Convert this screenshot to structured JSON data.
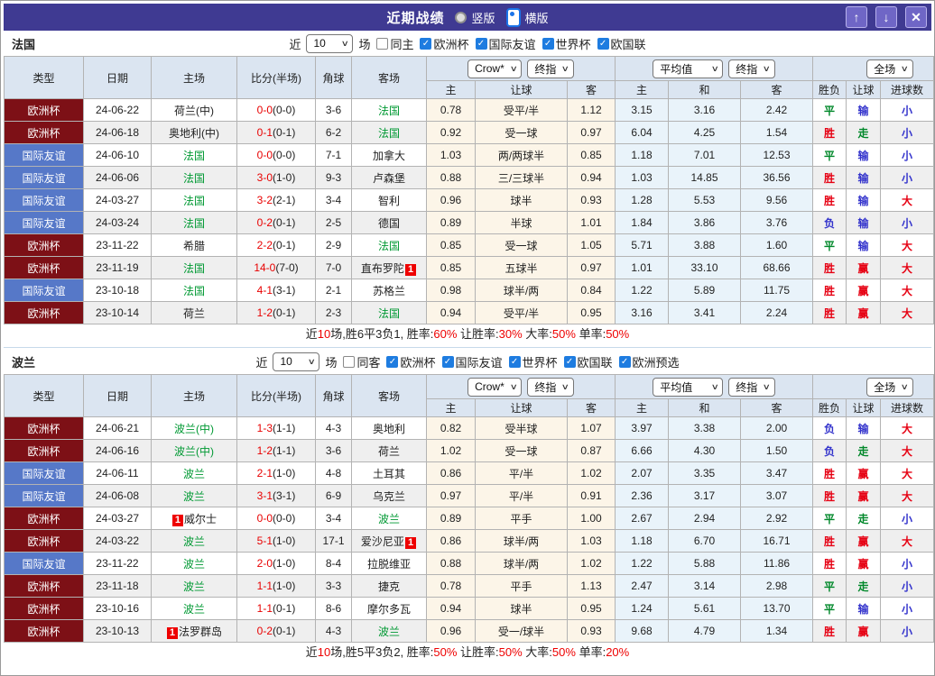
{
  "titlebar": {
    "title": "近期战绩",
    "radio_vertical": "竖版",
    "radio_horizontal": "横版",
    "up_icon": "↑",
    "down_icon": "↓",
    "close_icon": "✕"
  },
  "colors": {
    "titlebar_bg": "#3f3a92",
    "euro_cup_bg": "#7d1016",
    "friendly_bg": "#5678c8",
    "focus_team_green": "#009933",
    "score_red": "#e80000",
    "win_red": "#e60012",
    "draw_green": "#00882a",
    "loss_blue": "#3333cc",
    "odds_cream_bg": "#fcf5e8",
    "avg_blue_bg": "#e9f3fa"
  },
  "table_header": {
    "cols": [
      "类型",
      "日期",
      "主场",
      "比分(半场)",
      "角球",
      "客场"
    ],
    "dd_bookmaker": "Crow*",
    "dd_final_1": "终指",
    "dd_average": "平均值",
    "dd_final_2": "终指",
    "dd_fulltime": "全场",
    "sub_cols": [
      "主",
      "让球",
      "客",
      "主",
      "和",
      "客",
      "胜负",
      "让球",
      "进球数"
    ]
  },
  "sections": [
    {
      "team": "法国",
      "filter": {
        "near_label": "近",
        "count": "10",
        "games_label": "场",
        "same_label": "同主",
        "same_checked": false,
        "competitions": [
          "欧洲杯",
          "国际友谊",
          "世界杯",
          "欧国联"
        ]
      },
      "rows": [
        {
          "comp": "欧洲杯",
          "date": "24-06-22",
          "home": "荷兰(中)",
          "score": "0-0",
          "half": "(0-0)",
          "corner": "3-6",
          "away": "法国",
          "away_focus": true,
          "odds": [
            "0.78",
            "受平/半",
            "1.12"
          ],
          "avg": [
            "3.15",
            "3.16",
            "2.42"
          ],
          "res": [
            "平",
            "输",
            "小"
          ]
        },
        {
          "comp": "欧洲杯",
          "date": "24-06-18",
          "home": "奥地利(中)",
          "score": "0-1",
          "half": "(0-1)",
          "corner": "6-2",
          "away": "法国",
          "away_focus": true,
          "odds": [
            "0.92",
            "受一球",
            "0.97"
          ],
          "avg": [
            "6.04",
            "4.25",
            "1.54"
          ],
          "res": [
            "胜",
            "走",
            "小"
          ]
        },
        {
          "comp": "国际友谊",
          "date": "24-06-10",
          "home": "法国",
          "home_focus": true,
          "score": "0-0",
          "half": "(0-0)",
          "corner": "7-1",
          "away": "加拿大",
          "odds": [
            "1.03",
            "两/两球半",
            "0.85"
          ],
          "avg": [
            "1.18",
            "7.01",
            "12.53"
          ],
          "res": [
            "平",
            "输",
            "小"
          ]
        },
        {
          "comp": "国际友谊",
          "date": "24-06-06",
          "home": "法国",
          "home_focus": true,
          "score": "3-0",
          "half": "(1-0)",
          "corner": "9-3",
          "away": "卢森堡",
          "odds": [
            "0.88",
            "三/三球半",
            "0.94"
          ],
          "avg": [
            "1.03",
            "14.85",
            "36.56"
          ],
          "res": [
            "胜",
            "输",
            "小"
          ]
        },
        {
          "comp": "国际友谊",
          "date": "24-03-27",
          "home": "法国",
          "home_focus": true,
          "score": "3-2",
          "half": "(2-1)",
          "corner": "3-4",
          "away": "智利",
          "odds": [
            "0.96",
            "球半",
            "0.93"
          ],
          "avg": [
            "1.28",
            "5.53",
            "9.56"
          ],
          "res": [
            "胜",
            "输",
            "大"
          ]
        },
        {
          "comp": "国际友谊",
          "date": "24-03-24",
          "home": "法国",
          "home_focus": true,
          "score": "0-2",
          "half": "(0-1)",
          "corner": "2-5",
          "away": "德国",
          "odds": [
            "0.89",
            "半球",
            "1.01"
          ],
          "avg": [
            "1.84",
            "3.86",
            "3.76"
          ],
          "res": [
            "负",
            "输",
            "小"
          ]
        },
        {
          "comp": "欧洲杯",
          "date": "23-11-22",
          "home": "希腊",
          "score": "2-2",
          "half": "(0-1)",
          "corner": "2-9",
          "away": "法国",
          "away_focus": true,
          "odds": [
            "0.85",
            "受一球",
            "1.05"
          ],
          "avg": [
            "5.71",
            "3.88",
            "1.60"
          ],
          "res": [
            "平",
            "输",
            "大"
          ]
        },
        {
          "comp": "欧洲杯",
          "date": "23-11-19",
          "home": "法国",
          "home_focus": true,
          "score": "14-0",
          "half": "(7-0)",
          "corner": "7-0",
          "away": "直布罗陀",
          "away_badge": "1",
          "odds": [
            "0.85",
            "五球半",
            "0.97"
          ],
          "avg": [
            "1.01",
            "33.10",
            "68.66"
          ],
          "res": [
            "胜",
            "赢",
            "大"
          ]
        },
        {
          "comp": "国际友谊",
          "date": "23-10-18",
          "home": "法国",
          "home_focus": true,
          "score": "4-1",
          "half": "(3-1)",
          "corner": "2-1",
          "away": "苏格兰",
          "odds": [
            "0.98",
            "球半/两",
            "0.84"
          ],
          "avg": [
            "1.22",
            "5.89",
            "11.75"
          ],
          "res": [
            "胜",
            "赢",
            "大"
          ]
        },
        {
          "comp": "欧洲杯",
          "date": "23-10-14",
          "home": "荷兰",
          "score": "1-2",
          "half": "(0-1)",
          "corner": "2-3",
          "away": "法国",
          "away_focus": true,
          "odds": [
            "0.94",
            "受平/半",
            "0.95"
          ],
          "avg": [
            "3.16",
            "3.41",
            "2.24"
          ],
          "res": [
            "胜",
            "赢",
            "大"
          ]
        }
      ],
      "summary": [
        {
          "t": "近"
        },
        {
          "t": "10",
          "red": true
        },
        {
          "t": "场,胜6平3负1, 胜率:"
        },
        {
          "t": "60%",
          "red": true
        },
        {
          "t": " 让胜率:"
        },
        {
          "t": "30%",
          "red": true
        },
        {
          "t": " 大率:"
        },
        {
          "t": "50%",
          "red": true
        },
        {
          "t": " 单率:"
        },
        {
          "t": "50%",
          "red": true
        }
      ]
    },
    {
      "team": "波兰",
      "filter": {
        "near_label": "近",
        "count": "10",
        "games_label": "场",
        "same_label": "同客",
        "same_checked": false,
        "competitions": [
          "欧洲杯",
          "国际友谊",
          "世界杯",
          "欧国联",
          "欧洲预选"
        ]
      },
      "rows": [
        {
          "comp": "欧洲杯",
          "date": "24-06-21",
          "home": "波兰(中)",
          "home_focus": true,
          "score": "1-3",
          "half": "(1-1)",
          "corner": "4-3",
          "away": "奥地利",
          "odds": [
            "0.82",
            "受半球",
            "1.07"
          ],
          "avg": [
            "3.97",
            "3.38",
            "2.00"
          ],
          "res": [
            "负",
            "输",
            "大"
          ]
        },
        {
          "comp": "欧洲杯",
          "date": "24-06-16",
          "home": "波兰(中)",
          "home_focus": true,
          "score": "1-2",
          "half": "(1-1)",
          "corner": "3-6",
          "away": "荷兰",
          "odds": [
            "1.02",
            "受一球",
            "0.87"
          ],
          "avg": [
            "6.66",
            "4.30",
            "1.50"
          ],
          "res": [
            "负",
            "走",
            "大"
          ]
        },
        {
          "comp": "国际友谊",
          "date": "24-06-11",
          "home": "波兰",
          "home_focus": true,
          "score": "2-1",
          "half": "(1-0)",
          "corner": "4-8",
          "away": "土耳其",
          "odds": [
            "0.86",
            "平/半",
            "1.02"
          ],
          "avg": [
            "2.07",
            "3.35",
            "3.47"
          ],
          "res": [
            "胜",
            "赢",
            "大"
          ]
        },
        {
          "comp": "国际友谊",
          "date": "24-06-08",
          "home": "波兰",
          "home_focus": true,
          "score": "3-1",
          "half": "(3-1)",
          "corner": "6-9",
          "away": "乌克兰",
          "odds": [
            "0.97",
            "平/半",
            "0.91"
          ],
          "avg": [
            "2.36",
            "3.17",
            "3.07"
          ],
          "res": [
            "胜",
            "赢",
            "大"
          ]
        },
        {
          "comp": "欧洲杯",
          "date": "24-03-27",
          "home": "威尔士",
          "home_badge": "1",
          "score": "0-0",
          "half": "(0-0)",
          "corner": "3-4",
          "away": "波兰",
          "away_focus": true,
          "odds": [
            "0.89",
            "平手",
            "1.00"
          ],
          "avg": [
            "2.67",
            "2.94",
            "2.92"
          ],
          "res": [
            "平",
            "走",
            "小"
          ]
        },
        {
          "comp": "欧洲杯",
          "date": "24-03-22",
          "home": "波兰",
          "home_focus": true,
          "score": "5-1",
          "half": "(1-0)",
          "corner": "17-1",
          "away": "爱沙尼亚",
          "away_badge": "1",
          "odds": [
            "0.86",
            "球半/两",
            "1.03"
          ],
          "avg": [
            "1.18",
            "6.70",
            "16.71"
          ],
          "res": [
            "胜",
            "赢",
            "大"
          ]
        },
        {
          "comp": "国际友谊",
          "date": "23-11-22",
          "home": "波兰",
          "home_focus": true,
          "score": "2-0",
          "half": "(1-0)",
          "corner": "8-4",
          "away": "拉脱维亚",
          "odds": [
            "0.88",
            "球半/两",
            "1.02"
          ],
          "avg": [
            "1.22",
            "5.88",
            "11.86"
          ],
          "res": [
            "胜",
            "赢",
            "小"
          ]
        },
        {
          "comp": "欧洲杯",
          "date": "23-11-18",
          "home": "波兰",
          "home_focus": true,
          "score": "1-1",
          "half": "(1-0)",
          "corner": "3-3",
          "away": "捷克",
          "odds": [
            "0.78",
            "平手",
            "1.13"
          ],
          "avg": [
            "2.47",
            "3.14",
            "2.98"
          ],
          "res": [
            "平",
            "走",
            "小"
          ]
        },
        {
          "comp": "欧洲杯",
          "date": "23-10-16",
          "home": "波兰",
          "home_focus": true,
          "score": "1-1",
          "half": "(0-1)",
          "corner": "8-6",
          "away": "摩尔多瓦",
          "odds": [
            "0.94",
            "球半",
            "0.95"
          ],
          "avg": [
            "1.24",
            "5.61",
            "13.70"
          ],
          "res": [
            "平",
            "输",
            "小"
          ]
        },
        {
          "comp": "欧洲杯",
          "date": "23-10-13",
          "home": "法罗群岛",
          "home_badge": "1",
          "score": "0-2",
          "half": "(0-1)",
          "corner": "4-3",
          "away": "波兰",
          "away_focus": true,
          "odds": [
            "0.96",
            "受一/球半",
            "0.93"
          ],
          "avg": [
            "9.68",
            "4.79",
            "1.34"
          ],
          "res": [
            "胜",
            "赢",
            "小"
          ]
        }
      ],
      "summary": [
        {
          "t": "近"
        },
        {
          "t": "10",
          "red": true
        },
        {
          "t": "场,胜5平3负2, 胜率:"
        },
        {
          "t": "50%",
          "red": true
        },
        {
          "t": " 让胜率:"
        },
        {
          "t": "50%",
          "red": true
        },
        {
          "t": " 大率:"
        },
        {
          "t": "50%",
          "red": true
        },
        {
          "t": " 单率:"
        },
        {
          "t": "20%",
          "red": true
        }
      ]
    }
  ]
}
